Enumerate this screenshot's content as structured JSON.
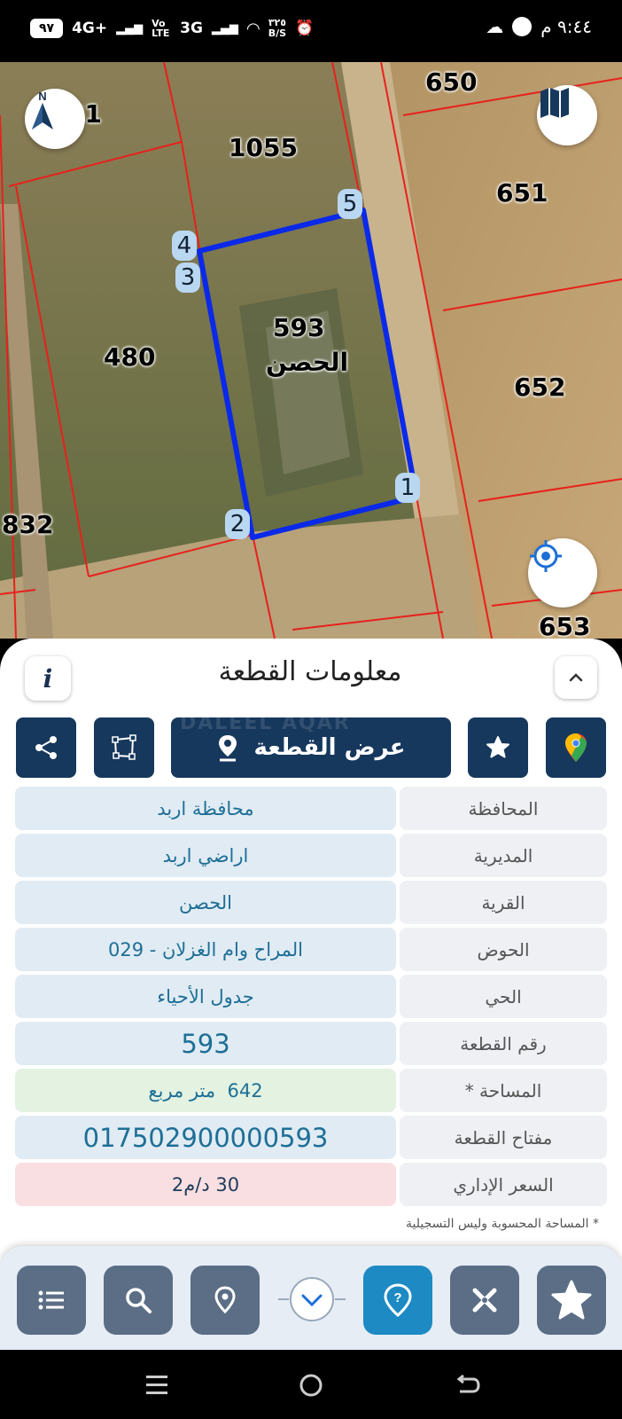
{
  "status_bar": {
    "battery": "٩٧",
    "network1": "4G+",
    "volte": "Vo LTE",
    "network2": "3G",
    "speed_value": "٣٢٥",
    "speed_unit": "B/S",
    "time": "٩:٤٤ م"
  },
  "map": {
    "parcels": [
      "31",
      "1055",
      "650",
      "651",
      "480",
      "652",
      "832",
      "653"
    ],
    "selected_parcel": "593",
    "selected_village": "الحصن",
    "vertices": [
      "1",
      "2",
      "3",
      "4",
      "5"
    ],
    "compass_label": "N"
  },
  "panel": {
    "title": "معلومات القطعة",
    "info_label": "i",
    "show_parcel_label": "عرض القطعة",
    "watermark": "DALEEL AQAR",
    "rows": [
      {
        "key": "المحافظة",
        "value": "محافظة اربد"
      },
      {
        "key": "المديرية",
        "value": "اراضي اربد"
      },
      {
        "key": "القرية",
        "value": "الحصن"
      },
      {
        "key": "الحوض",
        "value": "المراح وام الغزلان - 029"
      },
      {
        "key": "الحي",
        "value": "جدول الأحياء"
      },
      {
        "key": "رقم القطعة",
        "value": "593"
      },
      {
        "key": "المساحة *",
        "value": "642  متر مربع"
      },
      {
        "key": "مفتاح القطعة",
        "value": "017502900000593"
      },
      {
        "key": "السعر الإداري",
        "value": "30 د/م2"
      }
    ],
    "footnote": "* المساحة المحسوبة وليس التسجيلية"
  },
  "colors": {
    "primary": "#17385d",
    "accent": "#1d8ac4",
    "boundary": "#0a29e8",
    "parcel_line": "#e8201c"
  }
}
